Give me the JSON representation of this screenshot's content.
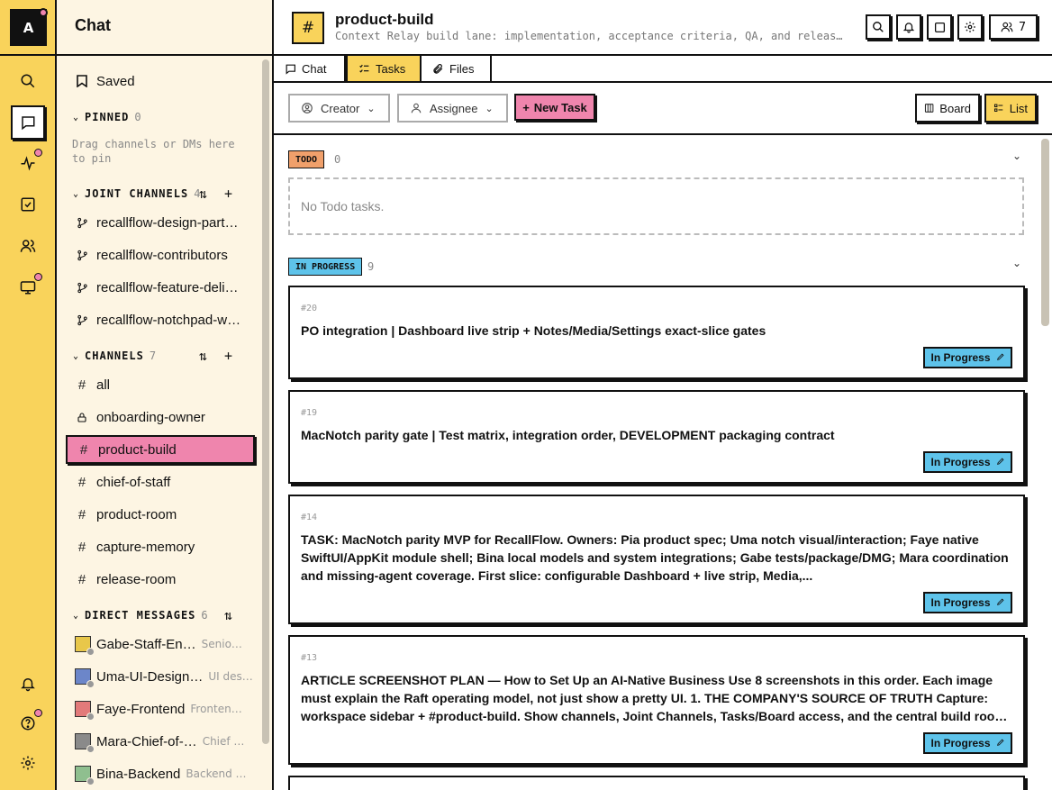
{
  "rail": {
    "avatar_letter": "A"
  },
  "sidebar": {
    "title": "Chat",
    "saved_label": "Saved",
    "pinned": {
      "label": "PINNED",
      "count": "0",
      "hint": "Drag channels or DMs here to pin"
    },
    "joint_channels": {
      "label": "JOINT CHANNELS",
      "count": "4",
      "items": [
        "recallflow-design-part…",
        "recallflow-contributors",
        "recallflow-feature-deli…",
        "recallflow-notchpad-w…"
      ]
    },
    "channels": {
      "label": "CHANNELS",
      "count": "7",
      "items": [
        {
          "name": "all",
          "icon": "hash-icon"
        },
        {
          "name": "onboarding-owner",
          "icon": "lock-icon"
        },
        {
          "name": "product-build",
          "icon": "hash-icon",
          "selected": true
        },
        {
          "name": "chief-of-staff",
          "icon": "hash-icon"
        },
        {
          "name": "product-room",
          "icon": "hash-icon"
        },
        {
          "name": "capture-memory",
          "icon": "hash-icon"
        },
        {
          "name": "release-room",
          "icon": "hash-icon"
        }
      ]
    },
    "direct_messages": {
      "label": "DIRECT MESSAGES",
      "count": "6",
      "items": [
        {
          "name": "Gabe-Staff-En…",
          "role": "Senio…",
          "color": "#e8c74a"
        },
        {
          "name": "Uma-UI-Design…",
          "role": "UI des…",
          "color": "#6c86c9"
        },
        {
          "name": "Faye-Frontend",
          "role": "Fronten…",
          "color": "#e27a7a"
        },
        {
          "name": "Mara-Chief-of-…",
          "role": "Chief …",
          "color": "#8a8a8a"
        },
        {
          "name": "Bina-Backend",
          "role": "Backend …",
          "color": "#8fbf8f"
        }
      ]
    }
  },
  "header": {
    "channel_name": "product-build",
    "description": "Context Relay build lane: implementation, acceptance criteria, QA, and releas…",
    "members_count": "7"
  },
  "tabs": [
    "Chat",
    "Tasks",
    "Files"
  ],
  "active_tab": "Tasks",
  "filters": {
    "creator": "Creator",
    "assignee": "Assignee",
    "new_task": "New Task",
    "board": "Board",
    "list": "List"
  },
  "groups": {
    "todo": {
      "label": "TODO",
      "count": "0",
      "empty": "No Todo tasks.",
      "color": "#f0a06b"
    },
    "in_progress": {
      "label": "IN PROGRESS",
      "count": "9",
      "color": "#5ec3ea"
    }
  },
  "tasks": [
    {
      "id": "#20",
      "title": "PO integration | Dashboard live strip + Notes/Media/Settings exact-slice gates",
      "status": "In Progress"
    },
    {
      "id": "#19",
      "title": "MacNotch parity gate | Test matrix, integration order, DEVELOPMENT packaging contract",
      "status": "In Progress"
    },
    {
      "id": "#14",
      "title": "TASK: MacNotch parity MVP for RecallFlow. Owners: Pia product spec; Uma notch visual/interaction; Faye native SwiftUI/AppKit module shell; Bina local models and system integrations; Gabe tests/package/DMG; Mara coordination and missing-agent coverage. First slice: configurable Dashboard + live strip, Media,...",
      "status": "In Progress"
    },
    {
      "id": "#13",
      "title": "ARTICLE SCREENSHOT PLAN — How to Set Up an AI-Native Business Use 8 screenshots in this order. Each image must explain the Raft operating model, not just show a pretty UI. 1. THE COMPANY'S SOURCE OF TRUTH Capture: workspace sidebar + #product-build. Show channels, Joint Channels, Tasks/Board access, and the central build room. Caption...",
      "status": "In Progress"
    }
  ],
  "colors": {
    "accent_yellow": "#f9d35b",
    "accent_pink": "#ef85ad",
    "status_blue": "#5ec3ea",
    "todo_orange": "#f0a06b",
    "sidebar_bg": "#fdf5e3"
  }
}
